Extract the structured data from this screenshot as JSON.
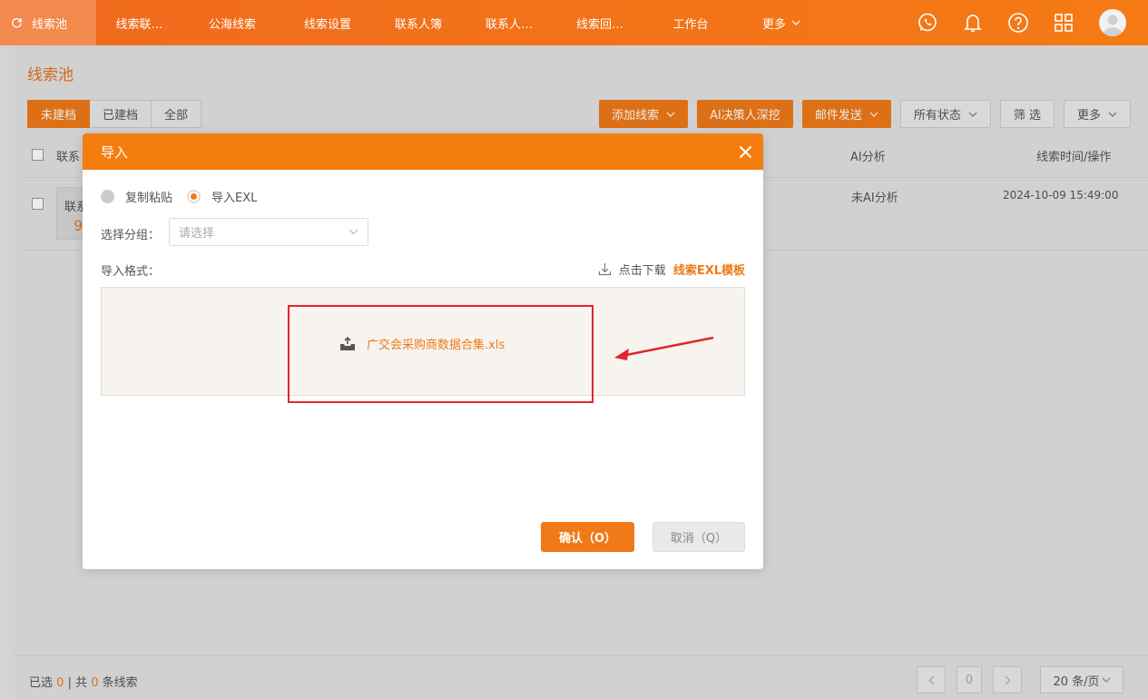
{
  "nav": {
    "items": [
      "线索池",
      "线索联…",
      "公海线索",
      "线索设置",
      "联系人簿",
      "联系人…",
      "线索回…",
      "工作台",
      "更多"
    ]
  },
  "page": {
    "title": "线索池",
    "segments": [
      "未建档",
      "已建档",
      "全部"
    ],
    "toolbar": {
      "add": "添加线索",
      "ai": "AI决策人深挖",
      "mail": "邮件发送",
      "status": "所有状态",
      "filter": "筛 选",
      "more": "更多"
    },
    "table": {
      "col_contact": "联系",
      "col_ai": "AI分析",
      "col_time": "线索时间/操作",
      "row": {
        "card_text": "联系",
        "card_num": "9",
        "ai": "未AI分析",
        "time": "2024-10-09 15:49:00"
      }
    }
  },
  "footer": {
    "selected_prefix": "已选",
    "selected": "0",
    "total_prefix": "| 共",
    "total": "0",
    "total_suffix": "条线索",
    "page": "0",
    "page_size": "20 条/页"
  },
  "modal": {
    "title": "导入",
    "radio_paste": "复制粘贴",
    "radio_exl": "导入EXL",
    "group_label": "选择分组：",
    "group_placeholder": "请选择",
    "format_label": "导入格式：",
    "download_text": "点击下载",
    "download_link": "线索EXL模板",
    "file_name": "广交会采购商数据合集.xls",
    "ok": "确认（O）",
    "cancel": "取消（Q）"
  }
}
